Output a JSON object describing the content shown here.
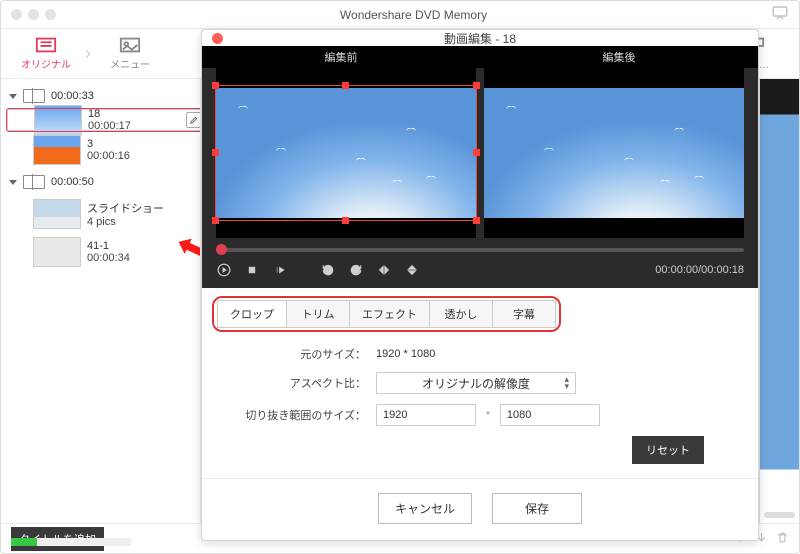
{
  "titlebar": {
    "title": "Wondershare DVD Memory"
  },
  "modebar": {
    "original": "オリジナル",
    "menu": "メニュー",
    "truncated": "ルボ…"
  },
  "sidebar": {
    "groups": [
      {
        "duration": "00:00:33",
        "items": [
          {
            "title": "18",
            "duration": "00:00:17",
            "selected": true,
            "thumb": "sky"
          },
          {
            "title": "3",
            "duration": "00:00:16",
            "selected": false,
            "thumb": "truck"
          }
        ]
      },
      {
        "duration": "00:00:50",
        "items": [
          {
            "title": "スライドショー",
            "duration": "4 pics",
            "selected": false,
            "thumb": "people"
          },
          {
            "title": "41-1",
            "duration": "00:00:34",
            "selected": false,
            "thumb": "beach"
          }
        ]
      }
    ],
    "add_title": "タイトルを追加"
  },
  "editor": {
    "window_title": "動画編集 - 18",
    "before_label": "編集前",
    "after_label": "編集後",
    "timecode": "00:00:00/00:00:18",
    "tabs": {
      "crop": "クロップ",
      "trim": "トリム",
      "effect": "エフェクト",
      "watermark": "透かし",
      "subtitle": "字幕"
    },
    "form": {
      "orig_size_label": "元のサイズ：",
      "orig_size_value": "1920 * 1080",
      "aspect_label": "アスペクト比：",
      "aspect_value": "オリジナルの解像度",
      "crop_size_label": "切り抜き範囲のサイズ：",
      "crop_w": "1920",
      "crop_h": "1080",
      "reset": "リセット"
    },
    "footer": {
      "cancel": "キャンセル",
      "save": "保存"
    }
  }
}
